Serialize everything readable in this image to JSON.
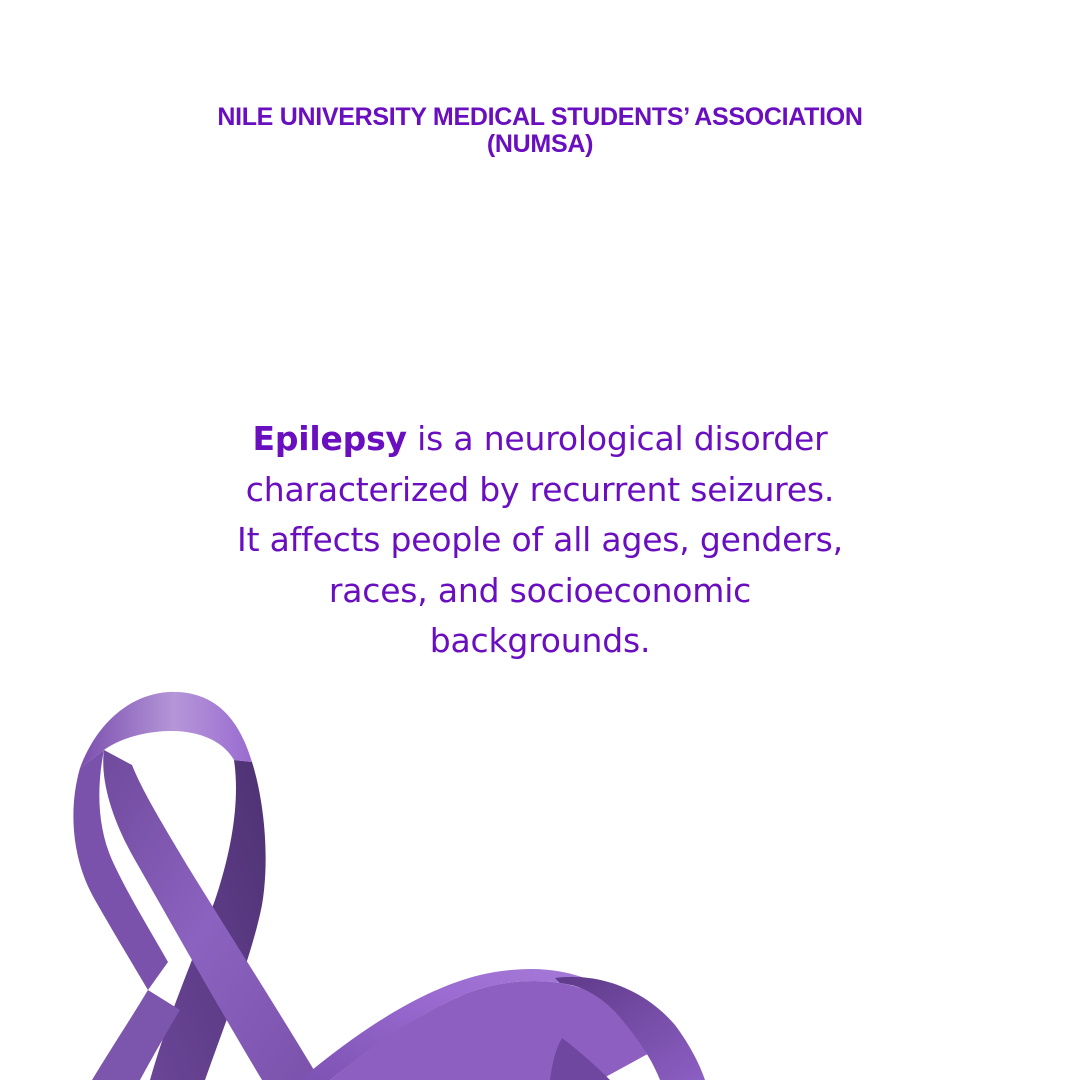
{
  "header": {
    "org_line1": "NILE UNIVERSITY MEDICAL STUDENTS’ ASSOCIATION",
    "org_line2": "(NUMSA)"
  },
  "main": {
    "term": "Epilepsy",
    "line1_rest": " is a neurological disorder",
    "line2": "characterized by recurrent seizures.",
    "line3": "It affects people of all ages, genders,",
    "line4": "races, and socioeconomic",
    "line5": "backgrounds."
  },
  "graphic": {
    "icon": "awareness-ribbon-icon",
    "ribbon_color": "#8d5fc0",
    "ribbon_dark": "#5e3a88",
    "ribbon_highlight": "#c3a9dd"
  },
  "colors": {
    "text": "#6a0fc0",
    "background": "#ffffff"
  }
}
